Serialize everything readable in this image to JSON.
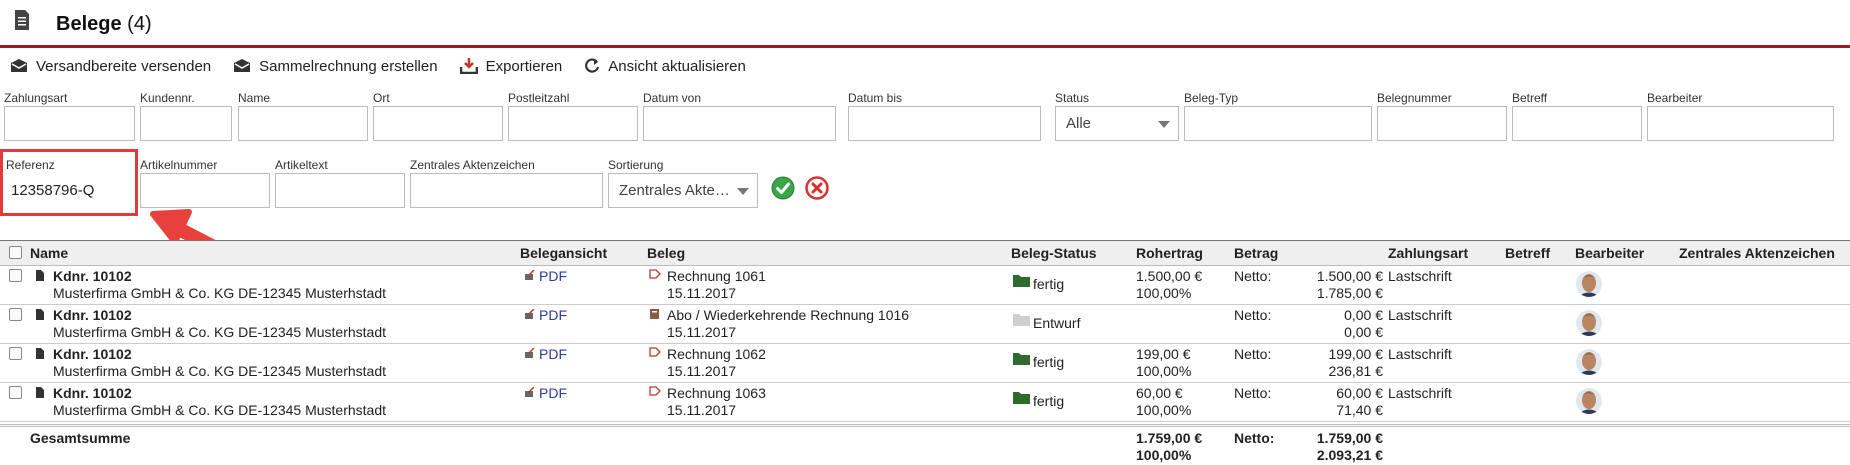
{
  "header": {
    "title": "Belege",
    "count": "(4)",
    "icon": "document-icon"
  },
  "toolbar": {
    "send_ready": "Versandbereite versenden",
    "collective_invoice": "Sammelrechnung erstellen",
    "export": "Exportieren",
    "refresh": "Ansicht aktualisieren"
  },
  "filters": {
    "zahlungsart": {
      "label": "Zahlungsart",
      "value": ""
    },
    "kundennr": {
      "label": "Kundennr.",
      "value": ""
    },
    "name": {
      "label": "Name",
      "value": ""
    },
    "ort": {
      "label": "Ort",
      "value": ""
    },
    "plz": {
      "label": "Postleitzahl",
      "value": ""
    },
    "datum_von": {
      "label": "Datum von",
      "value": ""
    },
    "datum_bis": {
      "label": "Datum bis",
      "value": ""
    },
    "status": {
      "label": "Status",
      "value": "Alle"
    },
    "beleg_typ": {
      "label": "Beleg-Typ",
      "value": ""
    },
    "belegnummer": {
      "label": "Belegnummer",
      "value": ""
    },
    "betreff": {
      "label": "Betreff",
      "value": ""
    },
    "bearbeiter": {
      "label": "Bearbeiter",
      "value": ""
    },
    "referenz": {
      "label": "Referenz",
      "value": "12358796-Q"
    },
    "artikelnummer": {
      "label": "Artikelnummer",
      "value": ""
    },
    "artikeltext": {
      "label": "Artikeltext",
      "value": ""
    },
    "aktenzeichen": {
      "label": "Zentrales Aktenzeichen",
      "value": ""
    },
    "sortierung": {
      "label": "Sortierung",
      "value": "Zentrales Akte…"
    }
  },
  "table": {
    "columns": {
      "name": "Name",
      "belegansicht": "Belegansicht",
      "beleg": "Beleg",
      "status": "Beleg-Status",
      "rohertrag": "Rohertrag",
      "betrag": "Betrag",
      "zahlungsart": "Zahlungsart",
      "betreff": "Betreff",
      "bearbeiter": "Bearbeiter",
      "aktenzeichen": "Zentrales Aktenzeichen"
    },
    "rows": [
      {
        "kdnr": "Kdnr. 10102",
        "company": "Musterfirma GmbH & Co. KG DE-12345 Musterhstadt",
        "view": "PDF",
        "beleg": "Rechnung 1061",
        "date": "15.11.2017",
        "status": "fertig",
        "rohertrag": "1.500,00 €",
        "rohertrag_pct": "100,00%",
        "netto_label": "Netto:",
        "netto": "1.500,00 €",
        "brutto": "1.785,00 €",
        "zahlungsart": "Lastschrift"
      },
      {
        "kdnr": "Kdnr. 10102",
        "company": "Musterfirma GmbH & Co. KG DE-12345 Musterhstadt",
        "view": "PDF",
        "beleg": "Abo / Wiederkehrende Rechnung 1016",
        "date": "15.11.2017",
        "status": "Entwurf",
        "rohertrag": "",
        "rohertrag_pct": "",
        "netto_label": "Netto:",
        "netto": "0,00 €",
        "brutto": "0,00 €",
        "zahlungsart": "Lastschrift"
      },
      {
        "kdnr": "Kdnr. 10102",
        "company": "Musterfirma GmbH & Co. KG DE-12345 Musterhstadt",
        "view": "PDF",
        "beleg": "Rechnung 1062",
        "date": "15.11.2017",
        "status": "fertig",
        "rohertrag": "199,00 €",
        "rohertrag_pct": "100,00%",
        "netto_label": "Netto:",
        "netto": "199,00 €",
        "brutto": "236,81 €",
        "zahlungsart": "Lastschrift"
      },
      {
        "kdnr": "Kdnr. 10102",
        "company": "Musterfirma GmbH & Co. KG DE-12345 Musterhstadt",
        "view": "PDF",
        "beleg": "Rechnung 1063",
        "date": "15.11.2017",
        "status": "fertig",
        "rohertrag": "60,00 €",
        "rohertrag_pct": "100,00%",
        "netto_label": "Netto:",
        "netto": "60,00 €",
        "brutto": "71,40 €",
        "zahlungsart": "Lastschrift"
      }
    ],
    "total": {
      "label": "Gesamtsumme",
      "rohertrag": "1.759,00 €",
      "rohertrag_pct": "100,00%",
      "netto_label": "Netto:",
      "netto": "1.759,00 €",
      "brutto": "2.093,21 €"
    }
  },
  "colors": {
    "accent_red": "#9b1c1c",
    "highlight": "#e03a3a",
    "link": "#2b3c9c",
    "ok_green": "#3aa64a",
    "cancel_red": "#d93030",
    "folder_green": "#2f6b2f"
  }
}
